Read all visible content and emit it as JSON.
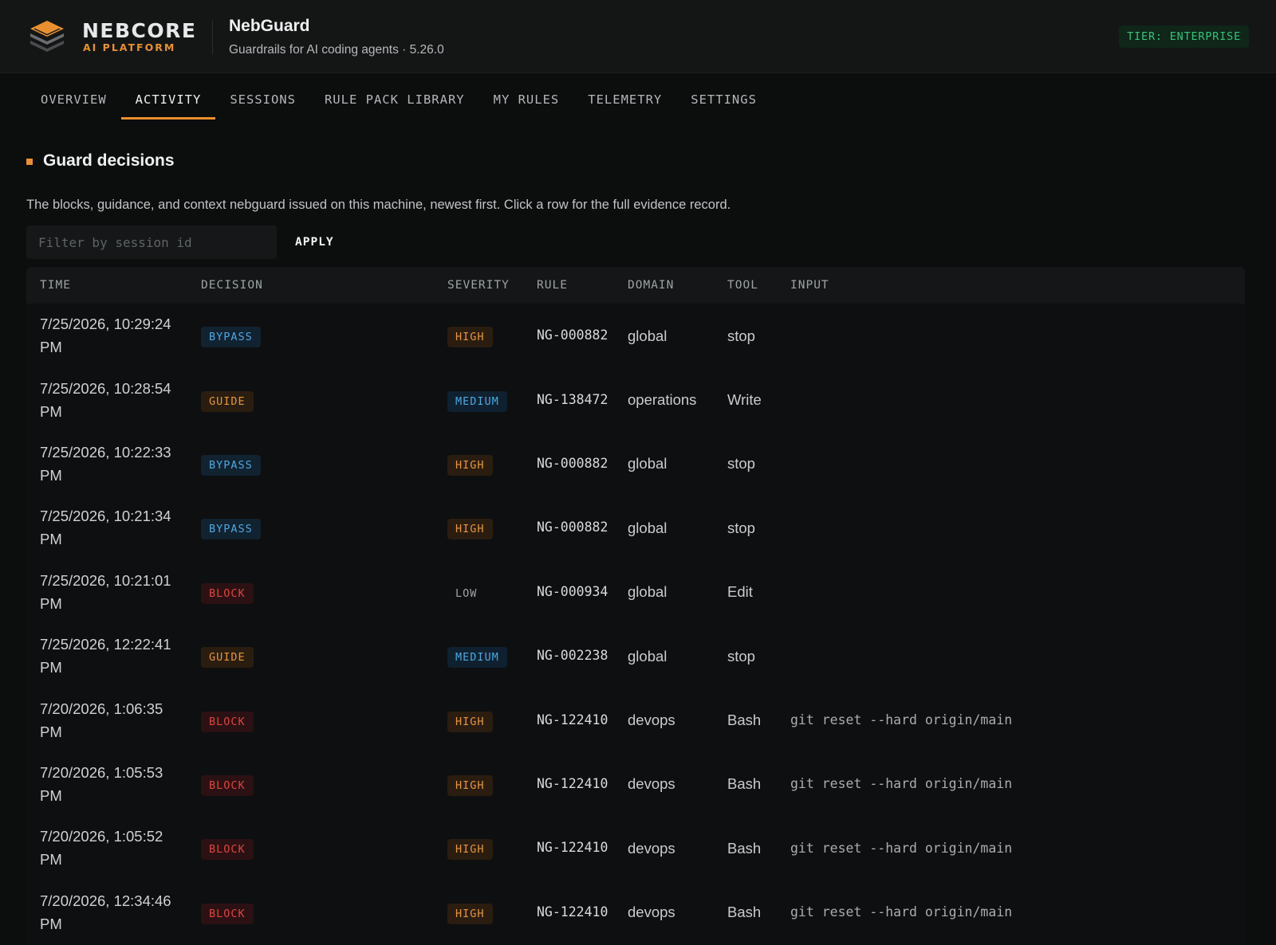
{
  "brand": {
    "name": "NEBCORE",
    "sub": "AI PLATFORM"
  },
  "app": {
    "title": "NebGuard",
    "subtitle": "Guardrails for AI coding agents · 5.26.0"
  },
  "tier_badge": "TIER: ENTERPRISE",
  "tabs": [
    "OVERVIEW",
    "ACTIVITY",
    "SESSIONS",
    "RULE PACK LIBRARY",
    "MY RULES",
    "TELEMETRY",
    "SETTINGS"
  ],
  "active_tab": "ACTIVITY",
  "section": {
    "title": "Guard decisions",
    "description": "The blocks, guidance, and context nebguard issued on this machine, newest first. Click a row for the full evidence record."
  },
  "filter": {
    "placeholder": "Filter by session id",
    "value": "",
    "apply_label": "APPLY"
  },
  "table": {
    "columns": [
      "TIME",
      "DECISION",
      "SEVERITY",
      "RULE",
      "DOMAIN",
      "TOOL",
      "INPUT"
    ],
    "rows": [
      {
        "time": "7/25/2026, 10:29:24 PM",
        "decision": "BYPASS",
        "severity": "HIGH",
        "rule": "NG-000882",
        "domain": "global",
        "tool": "stop",
        "input": ""
      },
      {
        "time": "7/25/2026, 10:28:54 PM",
        "decision": "GUIDE",
        "severity": "MEDIUM",
        "rule": "NG-138472",
        "domain": "operations",
        "tool": "Write",
        "input": ""
      },
      {
        "time": "7/25/2026, 10:22:33 PM",
        "decision": "BYPASS",
        "severity": "HIGH",
        "rule": "NG-000882",
        "domain": "global",
        "tool": "stop",
        "input": ""
      },
      {
        "time": "7/25/2026, 10:21:34 PM",
        "decision": "BYPASS",
        "severity": "HIGH",
        "rule": "NG-000882",
        "domain": "global",
        "tool": "stop",
        "input": ""
      },
      {
        "time": "7/25/2026, 10:21:01 PM",
        "decision": "BLOCK",
        "severity": "LOW",
        "rule": "NG-000934",
        "domain": "global",
        "tool": "Edit",
        "input": ""
      },
      {
        "time": "7/25/2026, 12:22:41 PM",
        "decision": "GUIDE",
        "severity": "MEDIUM",
        "rule": "NG-002238",
        "domain": "global",
        "tool": "stop",
        "input": ""
      },
      {
        "time": "7/20/2026, 1:06:35 PM",
        "decision": "BLOCK",
        "severity": "HIGH",
        "rule": "NG-122410",
        "domain": "devops",
        "tool": "Bash",
        "input": "git reset --hard origin/main"
      },
      {
        "time": "7/20/2026, 1:05:53 PM",
        "decision": "BLOCK",
        "severity": "HIGH",
        "rule": "NG-122410",
        "domain": "devops",
        "tool": "Bash",
        "input": "git reset --hard origin/main"
      },
      {
        "time": "7/20/2026, 1:05:52 PM",
        "decision": "BLOCK",
        "severity": "HIGH",
        "rule": "NG-122410",
        "domain": "devops",
        "tool": "Bash",
        "input": "git reset --hard origin/main"
      },
      {
        "time": "7/20/2026, 12:34:46 PM",
        "decision": "BLOCK",
        "severity": "HIGH",
        "rule": "NG-122410",
        "domain": "devops",
        "tool": "Bash",
        "input": "git reset --hard origin/main"
      }
    ]
  }
}
